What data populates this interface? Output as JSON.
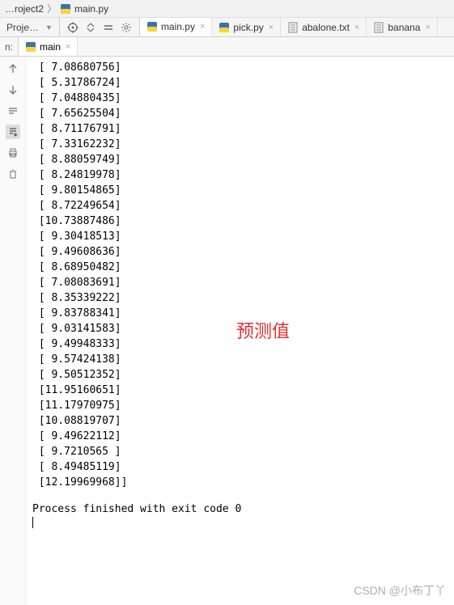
{
  "breadcrumb": {
    "item1": "…roject2",
    "item2": "main.py"
  },
  "toolbar": {
    "label": "Proje…"
  },
  "file_tabs": [
    {
      "name": "main.py",
      "type": "py",
      "active": true
    },
    {
      "name": "pick.py",
      "type": "py",
      "active": false
    },
    {
      "name": "abalone.txt",
      "type": "txt",
      "active": false
    },
    {
      "name": "banana",
      "type": "txt",
      "active": false
    }
  ],
  "run": {
    "label": "n:",
    "tab": "main"
  },
  "console_lines": [
    "[ 7.08680756]",
    "[ 5.31786724]",
    "[ 7.04880435]",
    "[ 7.65625504]",
    "[ 8.71176791]",
    "[ 7.33162232]",
    "[ 8.88059749]",
    "[ 8.24819978]",
    "[ 9.80154865]",
    "[ 8.72249654]",
    "[10.73887486]",
    "[ 9.30418513]",
    "[ 9.49608636]",
    "[ 8.68950482]",
    "[ 7.08083691]",
    "[ 8.35339222]",
    "[ 9.83788341]",
    "[ 9.03141583]",
    "[ 9.49948333]",
    "[ 9.57424138]",
    "[ 9.50512352]",
    "[11.95160651]",
    "[11.17970975]",
    "[10.08819707]",
    "[ 9.49622112]",
    "[ 9.7210565 ]",
    "[ 8.49485119]",
    "[12.19969968]]"
  ],
  "exit_message": "Process finished with exit code 0",
  "annotation": "预测值",
  "watermark": "CSDN @小布丁丫"
}
